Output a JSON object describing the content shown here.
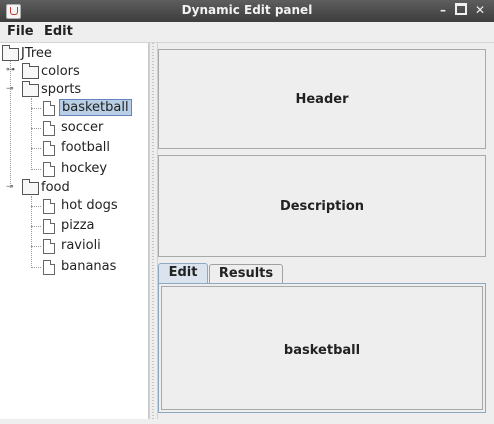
{
  "window": {
    "title": "Dynamic Edit panel",
    "min": "–",
    "max": "□",
    "close": "✕"
  },
  "menubar": {
    "items": [
      "File",
      "Edit"
    ]
  },
  "tree": {
    "root": "JTree",
    "nodes": [
      {
        "label": "colors",
        "type": "folder"
      },
      {
        "label": "sports",
        "type": "folder"
      },
      {
        "label": "basketball",
        "type": "leaf",
        "selected": true
      },
      {
        "label": "soccer",
        "type": "leaf"
      },
      {
        "label": "football",
        "type": "leaf"
      },
      {
        "label": "hockey",
        "type": "leaf"
      },
      {
        "label": "food",
        "type": "folder"
      },
      {
        "label": "hot dogs",
        "type": "leaf"
      },
      {
        "label": "pizza",
        "type": "leaf"
      },
      {
        "label": "ravioli",
        "type": "leaf"
      },
      {
        "label": "bananas",
        "type": "leaf"
      }
    ]
  },
  "panels": {
    "header": "Header",
    "description": "Description"
  },
  "tabs": {
    "items": [
      "Edit",
      "Results"
    ],
    "active": "Edit",
    "content": "basketball"
  },
  "colors": {
    "selection": "#b8cfe5",
    "titlebar": "#4a4a4a"
  }
}
